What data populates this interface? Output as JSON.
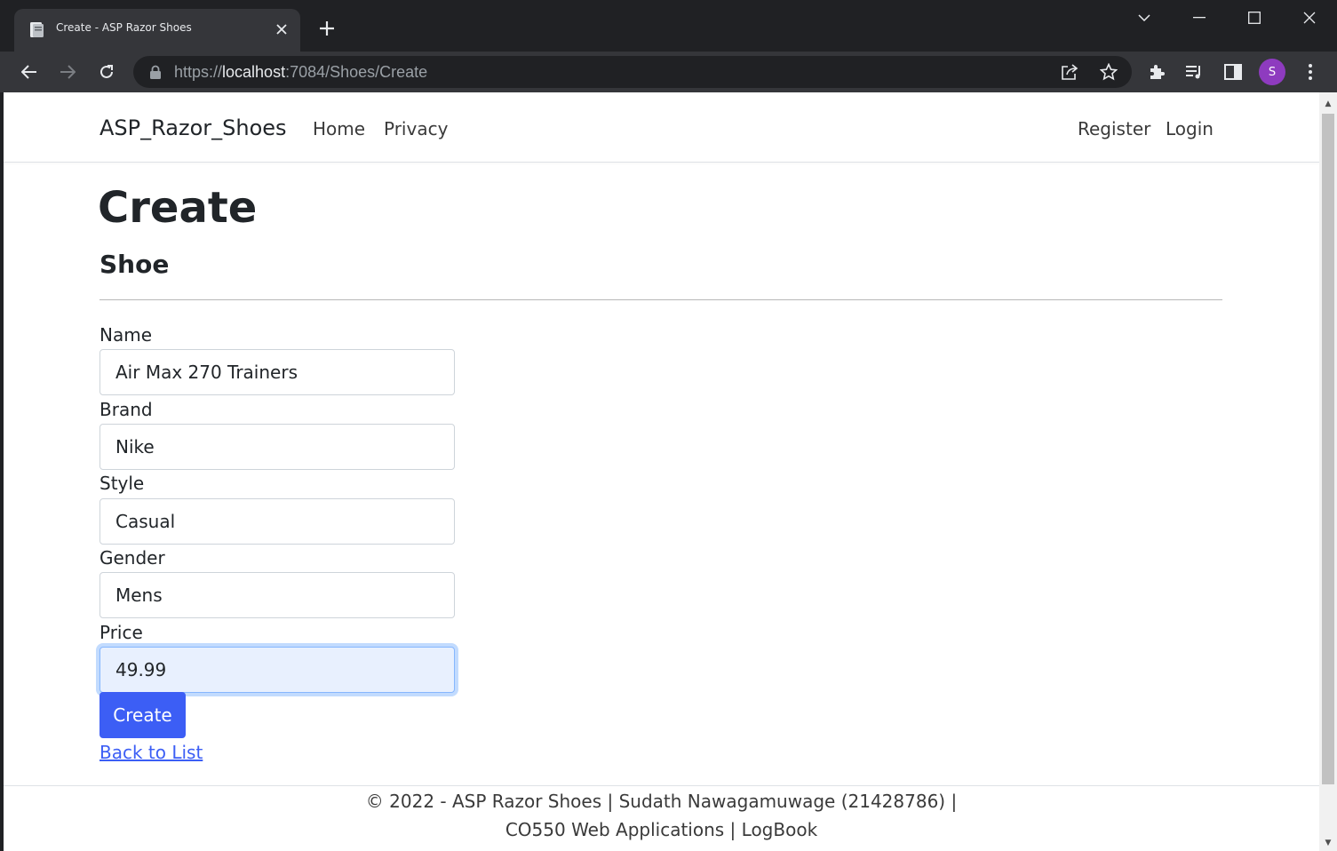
{
  "browser": {
    "tab_title": "Create - ASP Razor Shoes",
    "url_scheme": "https://",
    "url_host": "localhost",
    "url_rest": ":7084/Shoes/Create",
    "avatar_letter": "S",
    "accent_color": "#8e3bbf"
  },
  "navbar": {
    "brand": "ASP_Razor_Shoes",
    "links": [
      "Home",
      "Privacy"
    ],
    "auth_links": [
      "Register",
      "Login"
    ]
  },
  "main": {
    "title": "Create",
    "subtitle": "Shoe",
    "fields": [
      {
        "label": "Name",
        "value": "Air Max 270 Trainers"
      },
      {
        "label": "Brand",
        "value": "Nike"
      },
      {
        "label": "Style",
        "value": "Casual"
      },
      {
        "label": "Gender",
        "value": "Mens"
      },
      {
        "label": "Price",
        "value": "49.99"
      }
    ],
    "submit_label": "Create",
    "back_link": "Back to List",
    "primary_color": "#3c5ef5"
  },
  "footer": {
    "line1": "© 2022 - ASP Razor Shoes | Sudath Nawagamuwage (21428786) |",
    "line2": "CO550 Web Applications | LogBook"
  }
}
